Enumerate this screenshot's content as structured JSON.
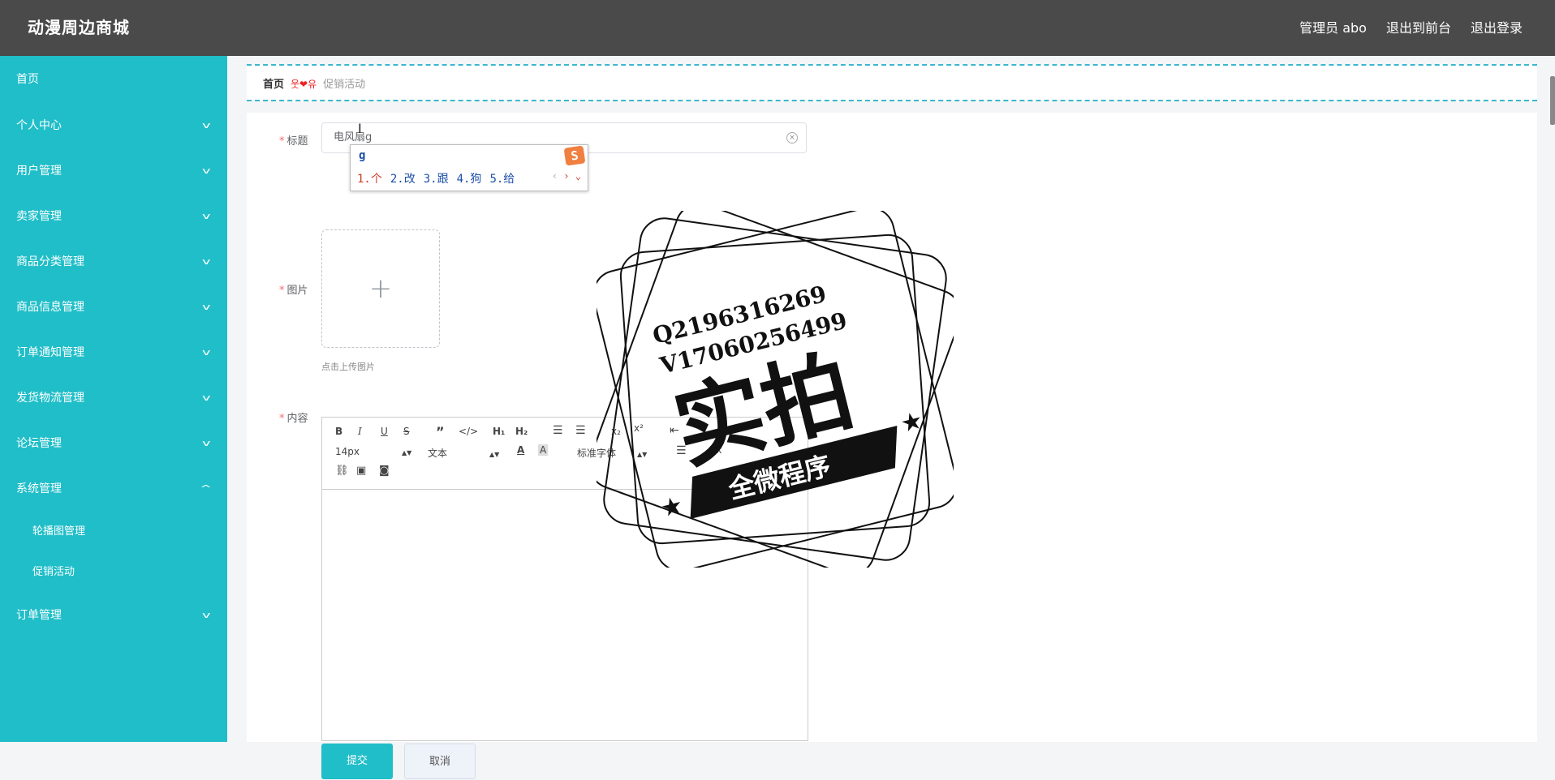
{
  "header": {
    "brand": "动漫周边商城",
    "links": [
      "管理员 abo",
      "退出到前台",
      "退出登录"
    ]
  },
  "sidebar": {
    "items": [
      {
        "label": "首页"
      },
      {
        "label": "个人中心",
        "expanded": false
      },
      {
        "label": "用户管理",
        "expanded": false
      },
      {
        "label": "卖家管理",
        "expanded": false
      },
      {
        "label": "商品分类管理",
        "expanded": false
      },
      {
        "label": "商品信息管理",
        "expanded": false
      },
      {
        "label": "订单通知管理",
        "expanded": false
      },
      {
        "label": "发货物流管理",
        "expanded": false
      },
      {
        "label": "论坛管理",
        "expanded": false
      },
      {
        "label": "系统管理",
        "expanded": true,
        "children": [
          "轮播图管理",
          "促销活动"
        ]
      },
      {
        "label": "订单管理",
        "expanded": false
      }
    ]
  },
  "breadcrumb": {
    "home": "首页",
    "separator": "웃❤유",
    "current": "促销活动"
  },
  "form": {
    "title_label": "标题",
    "title_value": "电风扇g",
    "image_label": "图片",
    "upload_tip": "点击上传图片",
    "content_label": "内容",
    "editor": {
      "font_size": "14px",
      "header_select": "文本",
      "font_family": "标准字体"
    },
    "submit_label": "提交",
    "cancel_label": "取消"
  },
  "ime": {
    "composition": "g",
    "candidates": [
      "1.个",
      "2.改",
      "3.跟",
      "4.狗",
      "5.给"
    ]
  },
  "watermark": {
    "line1": "Q2196316269",
    "line2": "V17060256499",
    "big": "实拍",
    "banner": "全微程序"
  },
  "colors": {
    "header": "#4a4a4a",
    "sidebar": "#20bec8",
    "accent": "#20bec8",
    "required": "#f56c6c"
  }
}
